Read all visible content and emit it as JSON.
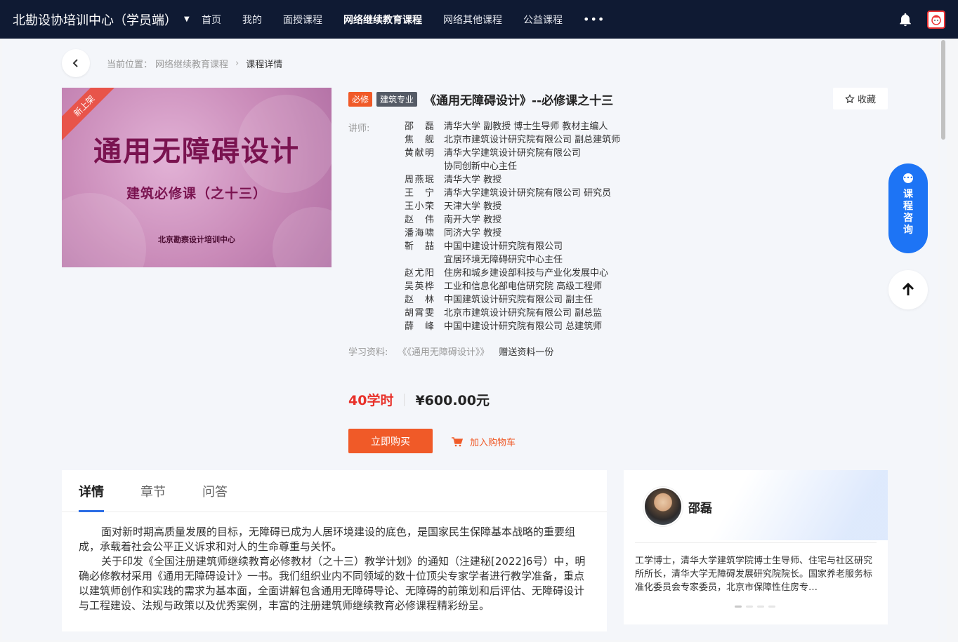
{
  "header": {
    "brand": "北勘设协培训中心（学员端）",
    "nav": [
      {
        "label": "首页"
      },
      {
        "label": "我的"
      },
      {
        "label": "面授课程"
      },
      {
        "label": "网络继续教育课程"
      },
      {
        "label": "网络其他课程"
      },
      {
        "label": "公益课程"
      }
    ],
    "more_label": "•••"
  },
  "breadcrumb": {
    "prefix": "当前位置：",
    "parent": "网络继续教育课程",
    "current": "课程详情"
  },
  "cover": {
    "ribbon": "新上架",
    "title": "通用无障碍设计",
    "subtitle": "建筑必修课（之十三）",
    "org": "北京勘察设计培训中心"
  },
  "course": {
    "tag_required": "必修",
    "tag_category": "建筑专业",
    "title": "《通用无障碍设计》--必修课之十三",
    "favorite_label": "收藏",
    "lecturers_label": "讲师:",
    "lecturers": [
      {
        "name": "邵磊",
        "org": [
          "清华大学  副教授 博士生导师 教材主编人"
        ]
      },
      {
        "name": "焦舰",
        "org": [
          "北京市建筑设计研究院有限公司 副总建筑师"
        ]
      },
      {
        "name": "黄献明",
        "org": [
          "清华大学建筑设计研究院有限公司",
          "协同创新中心主任"
        ]
      },
      {
        "name": "周燕珉",
        "org": [
          "清华大学  教授"
        ]
      },
      {
        "name": "王宁",
        "org": [
          "清华大学建筑设计研究院有限公司 研究员"
        ]
      },
      {
        "name": "王小荣",
        "org": [
          "天津大学  教授"
        ]
      },
      {
        "name": "赵伟",
        "org": [
          "南开大学  教授"
        ]
      },
      {
        "name": "潘海啸",
        "org": [
          "同济大学  教授"
        ]
      },
      {
        "name": "靳喆",
        "org": [
          "中国中建设计研究院有限公司",
          "宜居环境无障碍研究中心主任"
        ]
      },
      {
        "name": "赵尤阳",
        "org": [
          "住房和城乡建设部科技与产业化发展中心"
        ]
      },
      {
        "name": "吴英桦",
        "org": [
          "工业和信息化部电信研究院  高级工程师"
        ]
      },
      {
        "name": "赵林",
        "org": [
          "中国建筑设计研究院有限公司  副主任"
        ]
      },
      {
        "name": "胡霄雯",
        "org": [
          "北京市建筑设计研究院有限公司  副总监"
        ]
      },
      {
        "name": "薛峰",
        "org": [
          "中国中建设计研究院有限公司  总建筑师"
        ]
      }
    ],
    "materials_label": "学习资料:",
    "materials_link": "《《通用无障碍设计》》",
    "materials_gift": "赠送资料一份",
    "hours": "40学时",
    "price": "¥600.00元",
    "buy_label": "立即购买",
    "cart_label": "加入购物车"
  },
  "detail": {
    "tabs": [
      {
        "label": "详情"
      },
      {
        "label": "章节"
      },
      {
        "label": "问答"
      }
    ],
    "paragraphs": [
      "面对新时期高质量发展的目标，无障碍已成为人居环境建设的底色，是国家民生保障基本战略的重要组成，承载着社会公平正义诉求和对人的生命尊重与关怀。",
      "关于印发《全国注册建筑师继续教育必修教材（之十三）教学计划》的通知（注建秘[2022]6号）中，明确必修教材采用《通用无障碍设计》一书。我们组织业内不同领域的数十位顶尖专家学者进行教学准备，重点以建筑师创作和实践的需求为基本面，全面讲解包含通用无障碍导论、无障碍的前策划和后评估、无障碍设计与工程建设、法规与政策以及优秀案例，丰富的注册建筑师继续教育必修课程精彩纷呈。"
    ]
  },
  "teacher": {
    "name": "邵磊",
    "bio": "工学博士，清华大学建筑学院博士生导师、住宅与社区研究所所长，清华大学无障碍发展研究院院长。国家养老服务标准化委员会专家委员，北京市保障性住房专…"
  },
  "float": {
    "consult_label": "课程咨询"
  },
  "colors": {
    "nav_bg": "#0f1a33",
    "accent_orange": "#f05a28",
    "hours_red": "#e8312a",
    "consult_blue": "#1d74f5",
    "tab_underline": "#2b6de5"
  }
}
